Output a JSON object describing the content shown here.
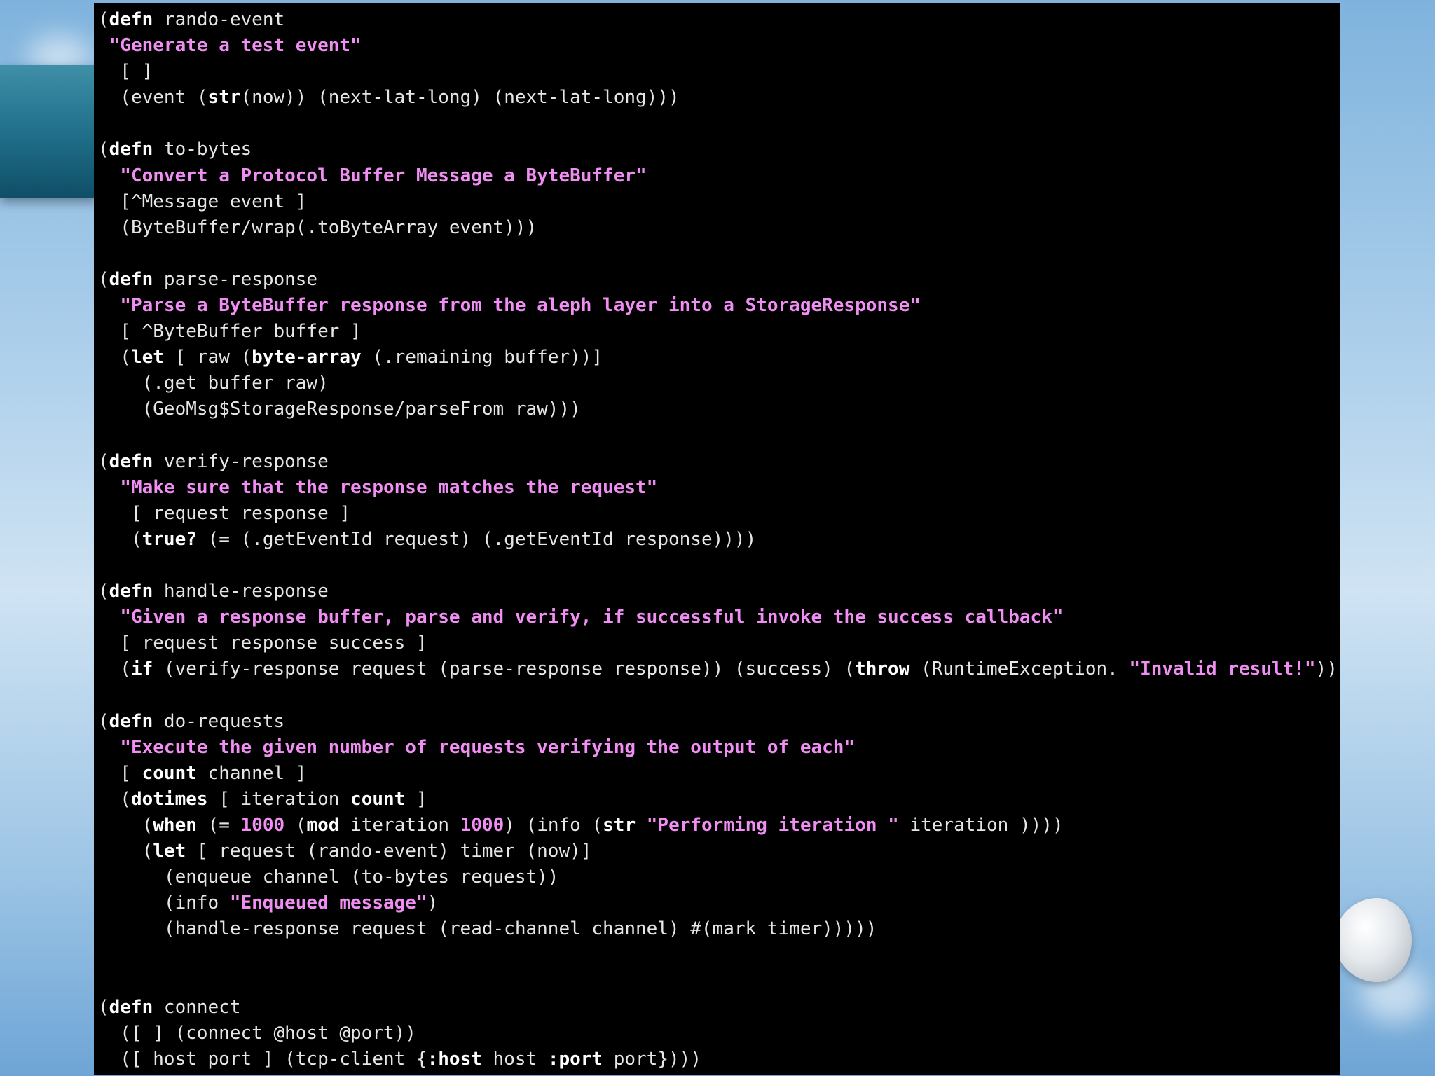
{
  "code_lines": [
    [
      {
        "t": "(",
        "c": "p"
      },
      {
        "t": "defn",
        "c": "kw"
      },
      {
        "t": " rando-event",
        "c": "p"
      }
    ],
    [
      {
        "t": " ",
        "c": "p"
      },
      {
        "t": "\"Generate a test event\"",
        "c": "doc"
      }
    ],
    [
      {
        "t": "  [ ]",
        "c": "p"
      }
    ],
    [
      {
        "t": "  (event (",
        "c": "p"
      },
      {
        "t": "str",
        "c": "kw"
      },
      {
        "t": "(now)) (next-lat-long) (next-lat-long)))",
        "c": "p"
      }
    ],
    [
      {
        "t": "",
        "c": "p"
      }
    ],
    [
      {
        "t": "(",
        "c": "p"
      },
      {
        "t": "defn",
        "c": "kw"
      },
      {
        "t": " to-bytes",
        "c": "p"
      }
    ],
    [
      {
        "t": "  ",
        "c": "p"
      },
      {
        "t": "\"Convert a Protocol Buffer Message a ByteBuffer\"",
        "c": "doc"
      }
    ],
    [
      {
        "t": "  [^Message event ]",
        "c": "p"
      }
    ],
    [
      {
        "t": "  (ByteBuffer/wrap(.toByteArray event)))",
        "c": "p"
      }
    ],
    [
      {
        "t": "",
        "c": "p"
      }
    ],
    [
      {
        "t": "(",
        "c": "p"
      },
      {
        "t": "defn",
        "c": "kw"
      },
      {
        "t": " parse-response",
        "c": "p"
      }
    ],
    [
      {
        "t": "  ",
        "c": "p"
      },
      {
        "t": "\"Parse a ByteBuffer response from the aleph layer into a StorageResponse\"",
        "c": "doc"
      }
    ],
    [
      {
        "t": "  [ ^ByteBuffer buffer ]",
        "c": "p"
      }
    ],
    [
      {
        "t": "  (",
        "c": "p"
      },
      {
        "t": "let",
        "c": "kw"
      },
      {
        "t": " [ raw (",
        "c": "p"
      },
      {
        "t": "byte-array",
        "c": "kw"
      },
      {
        "t": " (.remaining buffer))]",
        "c": "p"
      }
    ],
    [
      {
        "t": "    (.get buffer raw)",
        "c": "p"
      }
    ],
    [
      {
        "t": "    (GeoMsg$StorageResponse/parseFrom raw)))",
        "c": "p"
      }
    ],
    [
      {
        "t": "",
        "c": "p"
      }
    ],
    [
      {
        "t": "(",
        "c": "p"
      },
      {
        "t": "defn",
        "c": "kw"
      },
      {
        "t": " verify-response",
        "c": "p"
      }
    ],
    [
      {
        "t": "  ",
        "c": "p"
      },
      {
        "t": "\"Make sure that the response matches the request\"",
        "c": "doc"
      }
    ],
    [
      {
        "t": "   [ request response ]",
        "c": "p"
      }
    ],
    [
      {
        "t": "   (",
        "c": "p"
      },
      {
        "t": "true?",
        "c": "kw"
      },
      {
        "t": " (= (.getEventId request) (.getEventId response))))",
        "c": "p"
      }
    ],
    [
      {
        "t": "",
        "c": "p"
      }
    ],
    [
      {
        "t": "(",
        "c": "p"
      },
      {
        "t": "defn",
        "c": "kw"
      },
      {
        "t": " handle-response",
        "c": "p"
      }
    ],
    [
      {
        "t": "  ",
        "c": "p"
      },
      {
        "t": "\"Given a response buffer, parse and verify, if successful invoke the success callback\"",
        "c": "doc"
      }
    ],
    [
      {
        "t": "  [ request response success ]",
        "c": "p"
      }
    ],
    [
      {
        "t": "  (",
        "c": "p"
      },
      {
        "t": "if",
        "c": "kw"
      },
      {
        "t": " (verify-response request (parse-response response)) (success) (",
        "c": "p"
      },
      {
        "t": "throw",
        "c": "kw"
      },
      {
        "t": " (RuntimeException. ",
        "c": "p"
      },
      {
        "t": "\"Invalid result!\"",
        "c": "doc"
      },
      {
        "t": "))))",
        "c": "p"
      }
    ],
    [
      {
        "t": "",
        "c": "p"
      }
    ],
    [
      {
        "t": "(",
        "c": "p"
      },
      {
        "t": "defn",
        "c": "kw"
      },
      {
        "t": " do-requests",
        "c": "p"
      }
    ],
    [
      {
        "t": "  ",
        "c": "p"
      },
      {
        "t": "\"Execute the given number of requests verifying the output of each\"",
        "c": "doc"
      }
    ],
    [
      {
        "t": "  [ ",
        "c": "p"
      },
      {
        "t": "count",
        "c": "kw"
      },
      {
        "t": " channel ]",
        "c": "p"
      }
    ],
    [
      {
        "t": "  (",
        "c": "p"
      },
      {
        "t": "dotimes",
        "c": "kw"
      },
      {
        "t": " [ iteration ",
        "c": "p"
      },
      {
        "t": "count",
        "c": "kw"
      },
      {
        "t": " ]",
        "c": "p"
      }
    ],
    [
      {
        "t": "    (",
        "c": "p"
      },
      {
        "t": "when",
        "c": "kw"
      },
      {
        "t": " (= ",
        "c": "p"
      },
      {
        "t": "1000",
        "c": "num"
      },
      {
        "t": " (",
        "c": "p"
      },
      {
        "t": "mod",
        "c": "kw"
      },
      {
        "t": " iteration ",
        "c": "p"
      },
      {
        "t": "1000",
        "c": "num"
      },
      {
        "t": ") (info (",
        "c": "p"
      },
      {
        "t": "str",
        "c": "kw"
      },
      {
        "t": " ",
        "c": "p"
      },
      {
        "t": "\"Performing iteration \"",
        "c": "doc"
      },
      {
        "t": " iteration ))))",
        "c": "p"
      }
    ],
    [
      {
        "t": "    (",
        "c": "p"
      },
      {
        "t": "let",
        "c": "kw"
      },
      {
        "t": " [ request (rando-event) timer (now)]",
        "c": "p"
      }
    ],
    [
      {
        "t": "      (enqueue channel (to-bytes request))",
        "c": "p"
      }
    ],
    [
      {
        "t": "      (info ",
        "c": "p"
      },
      {
        "t": "\"Enqueued message\"",
        "c": "doc"
      },
      {
        "t": ")",
        "c": "p"
      }
    ],
    [
      {
        "t": "      (handle-response request (read-channel channel) #(mark timer)))))",
        "c": "p"
      }
    ],
    [
      {
        "t": "",
        "c": "p"
      }
    ],
    [
      {
        "t": "",
        "c": "p"
      }
    ],
    [
      {
        "t": "(",
        "c": "p"
      },
      {
        "t": "defn",
        "c": "kw"
      },
      {
        "t": " connect",
        "c": "p"
      }
    ],
    [
      {
        "t": "  ([ ] (connect @host @port))",
        "c": "p"
      }
    ],
    [
      {
        "t": "  ([ host port ] (tcp-client {",
        "c": "p"
      },
      {
        "t": ":host",
        "c": "kw"
      },
      {
        "t": " host ",
        "c": "p"
      },
      {
        "t": ":port",
        "c": "kw"
      },
      {
        "t": " port})))",
        "c": "p"
      }
    ]
  ]
}
